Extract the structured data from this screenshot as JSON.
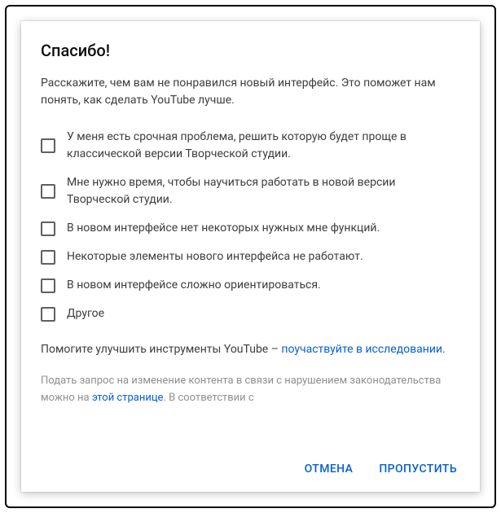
{
  "heading": "Спасибо!",
  "intro": "Расскажите, чем вам не понравился новый интерфейс. Это поможет нам понять, как сделать YouTube лучше.",
  "options": [
    "У меня есть срочная проблема, решить которую будет проще в классической версии Творческой студии.",
    "Мне нужно время, чтобы научиться работать в новой версии Творческой студии.",
    "В новом интерфейсе нет некоторых нужных мне функций.",
    "Некоторые элементы нового интерфейса не работают.",
    "В новом интерфейсе сложно ориентироваться.",
    "Другое"
  ],
  "help": {
    "prefix": "Помогите улучшить инструменты YouTube – ",
    "link": "поучаствуйте в исследовании",
    "suffix": "."
  },
  "legal": {
    "prefix": "Подать запрос на изменение контента в связи с нарушением законодательства можно на ",
    "link": "этой странице",
    "suffix": ". В соответствии с"
  },
  "actions": {
    "cancel": "ОТМЕНА",
    "skip": "ПРОПУСТИТЬ"
  }
}
